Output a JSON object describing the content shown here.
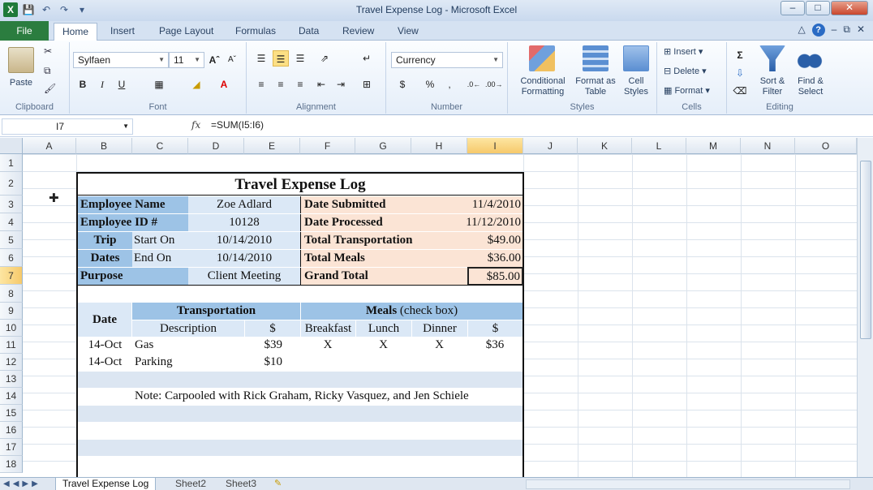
{
  "window": {
    "title": "Travel Expense Log - Microsoft Excel"
  },
  "ribbon_tabs": [
    "File",
    "Home",
    "Insert",
    "Page Layout",
    "Formulas",
    "Data",
    "Review",
    "View"
  ],
  "ribbon": {
    "clipboard": {
      "paste": "Paste",
      "label": "Clipboard"
    },
    "font": {
      "name": "Sylfaen",
      "size": "11",
      "label": "Font",
      "bold": "B",
      "italic": "I",
      "underline": "U"
    },
    "alignment": {
      "label": "Alignment"
    },
    "number": {
      "format": "Currency",
      "dollar": "$",
      "percent": "%",
      "comma": ",",
      "inc": "+.0 .00",
      "dec": ".00 →.0",
      "label": "Number"
    },
    "styles": {
      "conditional": "Conditional Formatting",
      "format_table": "Format as Table",
      "cell_styles": "Cell Styles",
      "label": "Styles"
    },
    "cells": {
      "insert": "Insert",
      "delete": "Delete",
      "format": "Format",
      "label": "Cells"
    },
    "editing": {
      "sort": "Sort & Filter",
      "find": "Find & Select",
      "label": "Editing",
      "sigma": "Σ"
    }
  },
  "formula_bar": {
    "name_box": "I7",
    "fx": "fx",
    "formula": "=SUM(I5:I6)"
  },
  "columns": [
    "A",
    "B",
    "C",
    "D",
    "E",
    "F",
    "G",
    "H",
    "I",
    "J",
    "K",
    "L",
    "M",
    "N",
    "O"
  ],
  "rows": [
    "1",
    "2",
    "3",
    "4",
    "5",
    "6",
    "7",
    "8",
    "9",
    "10",
    "11",
    "12",
    "13",
    "14",
    "15",
    "16",
    "17",
    "18"
  ],
  "sheet": {
    "title": "Travel Expense Log",
    "employee_name_label": "Employee Name",
    "employee_name": "Zoe Adlard",
    "employee_id_label": "Employee ID #",
    "employee_id": "10128",
    "trip_label": "Trip",
    "dates_label": "Dates",
    "start_on_label": "Start On",
    "start_on": "10/14/2010",
    "end_on_label": "End On",
    "end_on": "10/14/2010",
    "purpose_label": "Purpose",
    "purpose": "Client Meeting",
    "date_submitted_label": "Date Submitted",
    "date_submitted": "11/4/2010",
    "date_processed_label": "Date Processed",
    "date_processed": "11/12/2010",
    "total_transportation_label": "Total Transportation",
    "total_transportation": "$49.00",
    "total_meals_label": "Total Meals",
    "total_meals": "$36.00",
    "grand_total_label": "Grand Total",
    "grand_total": "$85.00",
    "hdr_date": "Date",
    "hdr_transportation": "Transportation",
    "hdr_meals": "Meals",
    "hdr_meals_note": "(check box)",
    "hdr_description": "Description",
    "hdr_dollar": "$",
    "hdr_breakfast": "Breakfast",
    "hdr_lunch": "Lunch",
    "hdr_dinner": "Dinner",
    "hdr_meal_dollar": "$",
    "entries": [
      {
        "date": "14-Oct",
        "desc": "Gas",
        "amount": "$39",
        "breakfast": "X",
        "lunch": "X",
        "dinner": "X",
        "meals": "$36"
      },
      {
        "date": "14-Oct",
        "desc": "Parking",
        "amount": "$10",
        "breakfast": "",
        "lunch": "",
        "dinner": "",
        "meals": ""
      }
    ],
    "note": "Note: Carpooled with Rick Graham, Ricky Vasquez, and Jen Schiele"
  },
  "sheet_tabs": [
    "Travel Expense Log",
    "Sheet2",
    "Sheet3"
  ]
}
